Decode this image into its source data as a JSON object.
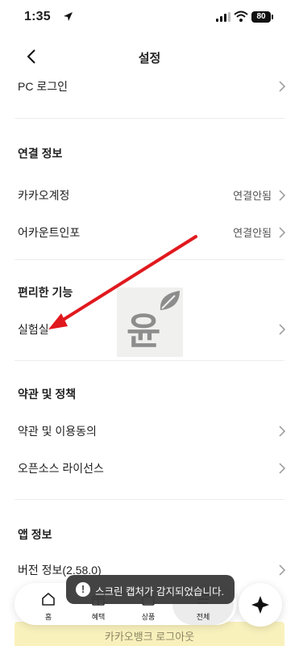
{
  "status_bar": {
    "time": "1:35",
    "battery": "80"
  },
  "header": {
    "title": "설정"
  },
  "rows": {
    "pc_login": "PC 로그인",
    "kakao_account": {
      "label": "카카오계정",
      "value": "연결안됨"
    },
    "account_info": {
      "label": "어카운트인포",
      "value": "연결안됨"
    },
    "lab": "실험실",
    "terms_consent": "약관 및 이용동의",
    "open_source": "오픈소스 라이선스",
    "version": "버전 정보(2.58.0)"
  },
  "sections": {
    "connection": "연결 정보",
    "features": "편리한 기능",
    "policies": "약관 및 정책",
    "app_info": "앱 정보"
  },
  "watermark": {
    "text": "윤"
  },
  "toast": {
    "message": "스크린 캡처가 감지되었습니다."
  },
  "nav": {
    "home": "홈",
    "benefits": "혜택",
    "products": "상품",
    "all": "전체"
  },
  "login_button": "카카오뱅크 로그아웃",
  "colors": {
    "arrow": "#e0191e",
    "login_strip": "#f9f1bc",
    "toast": "#3c3c3c"
  }
}
